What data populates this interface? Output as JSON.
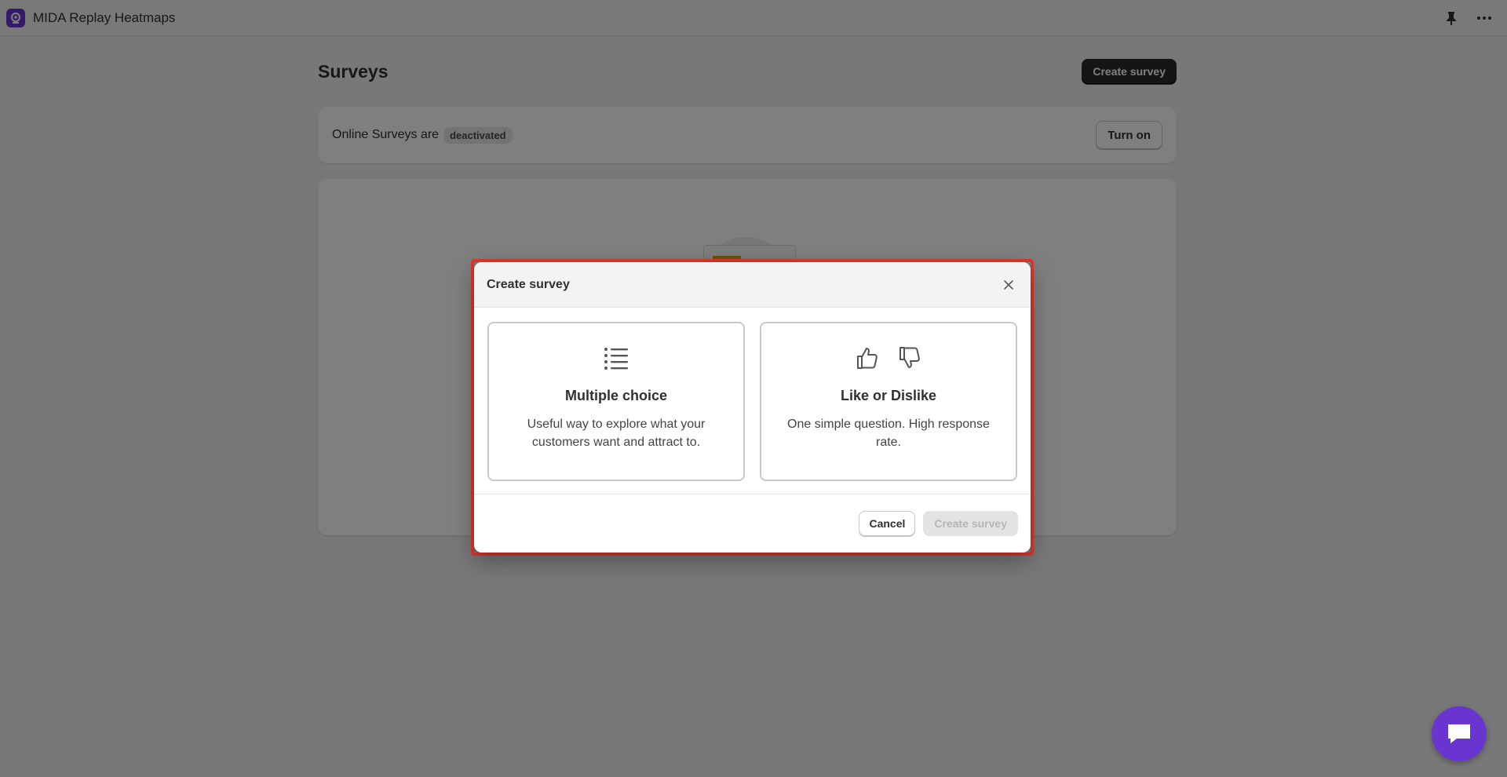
{
  "app": {
    "title": "MIDA Replay Heatmaps",
    "brand_color": "#6a34d0"
  },
  "topbar": {
    "icons": [
      "pin-icon",
      "more-icon"
    ]
  },
  "page": {
    "title": "Surveys",
    "create_button": "Create survey",
    "status": {
      "prefix": "Online Surveys are",
      "badge": "deactivated",
      "button": "Turn on"
    }
  },
  "modal": {
    "title": "Create survey",
    "options": [
      {
        "icon": "list-icon",
        "title": "Multiple choice",
        "description": "Useful way to explore what your customers want and attract to."
      },
      {
        "icon": "thumbs-up-down-icon",
        "title": "Like or Dislike",
        "description": "One simple question. High response rate."
      }
    ],
    "cancel": "Cancel",
    "submit": "Create survey",
    "highlight_color": "#e0382d"
  },
  "chat": {
    "icon": "chat-icon"
  }
}
